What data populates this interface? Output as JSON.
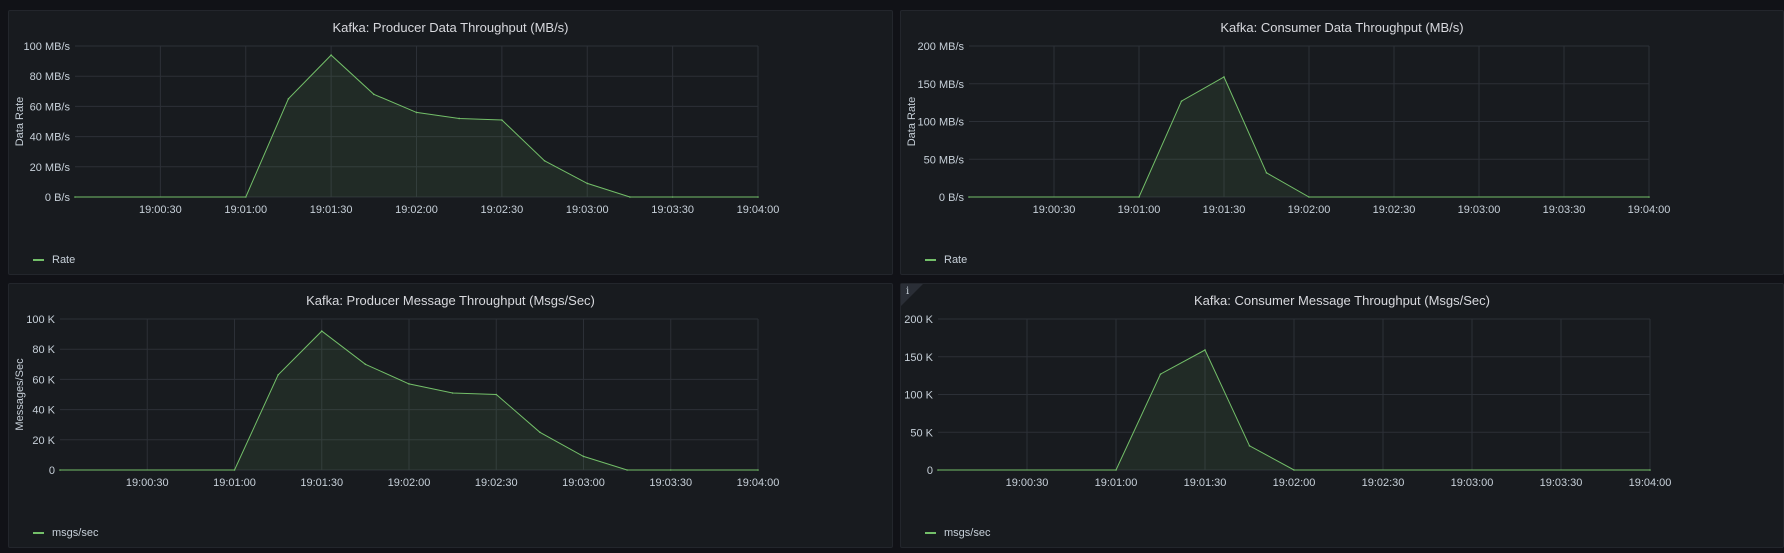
{
  "accent_color": "#73bf69",
  "chart_data": [
    {
      "id": "producer-data",
      "type": "area",
      "title": "Kafka: Producer Data Throughput (MB/s)",
      "ylabel": "Data Rate",
      "ylim": [
        0,
        100
      ],
      "yticks": [
        0,
        20,
        40,
        60,
        80,
        100
      ],
      "ytick_labels": [
        "0 B/s",
        "20 MB/s",
        "40 MB/s",
        "60 MB/s",
        "80 MB/s",
        "100 MB/s"
      ],
      "xlim": [
        "19:00:00",
        "19:04:00"
      ],
      "xtick_labels": [
        "19:00:30",
        "19:01:00",
        "19:01:30",
        "19:02:00",
        "19:02:30",
        "19:03:00",
        "19:03:30",
        "19:04:00"
      ],
      "grid": true,
      "legend_position": "bottom-left",
      "series": [
        {
          "name": "Rate",
          "color": "#73bf69",
          "x": [
            "19:00:00",
            "19:01:00",
            "19:01:15",
            "19:01:30",
            "19:01:45",
            "19:02:00",
            "19:02:15",
            "19:02:30",
            "19:02:45",
            "19:03:00",
            "19:03:15",
            "19:03:30",
            "19:04:00"
          ],
          "y": [
            0,
            0,
            65,
            94,
            68,
            56,
            52,
            51,
            24,
            9,
            0,
            0,
            0
          ]
        }
      ]
    },
    {
      "id": "consumer-data",
      "type": "area",
      "title": "Kafka: Consumer Data Throughput (MB/s)",
      "ylabel": "Data Rate",
      "ylim": [
        0,
        200
      ],
      "yticks": [
        0,
        50,
        100,
        150,
        200
      ],
      "ytick_labels": [
        "0 B/s",
        "50 MB/s",
        "100 MB/s",
        "150 MB/s",
        "200 MB/s"
      ],
      "xlim": [
        "19:00:00",
        "19:04:00"
      ],
      "xtick_labels": [
        "19:00:30",
        "19:01:00",
        "19:01:30",
        "19:02:00",
        "19:02:30",
        "19:03:00",
        "19:03:30",
        "19:04:00"
      ],
      "grid": true,
      "legend_position": "bottom-left",
      "series": [
        {
          "name": "Rate",
          "color": "#73bf69",
          "x": [
            "19:00:00",
            "19:01:00",
            "19:01:15",
            "19:01:30",
            "19:01:45",
            "19:02:00",
            "19:04:00"
          ],
          "y": [
            0,
            0,
            127,
            159,
            32,
            0,
            0
          ]
        }
      ]
    },
    {
      "id": "producer-msgs",
      "type": "area",
      "title": "Kafka: Producer Message Throughput (Msgs/Sec)",
      "ylabel": "Messages/Sec",
      "ylim": [
        0,
        100000
      ],
      "yticks": [
        0,
        20000,
        40000,
        60000,
        80000,
        100000
      ],
      "ytick_labels": [
        "0",
        "20 K",
        "40 K",
        "60 K",
        "80 K",
        "100 K"
      ],
      "xlim": [
        "19:00:00",
        "19:04:00"
      ],
      "xtick_labels": [
        "19:00:30",
        "19:01:00",
        "19:01:30",
        "19:02:00",
        "19:02:30",
        "19:03:00",
        "19:03:30",
        "19:04:00"
      ],
      "grid": true,
      "legend_position": "bottom-left",
      "series": [
        {
          "name": "msgs/sec",
          "color": "#73bf69",
          "x": [
            "19:00:00",
            "19:01:00",
            "19:01:15",
            "19:01:30",
            "19:01:45",
            "19:02:00",
            "19:02:15",
            "19:02:30",
            "19:02:45",
            "19:03:00",
            "19:03:15",
            "19:03:30",
            "19:04:00"
          ],
          "y": [
            0,
            0,
            63000,
            92000,
            70000,
            57000,
            51000,
            50000,
            25000,
            9000,
            0,
            0,
            0
          ]
        }
      ]
    },
    {
      "id": "consumer-msgs",
      "type": "area",
      "title": "Kafka: Consumer Message Throughput (Msgs/Sec)",
      "ylabel": "",
      "ylim": [
        0,
        200000
      ],
      "yticks": [
        0,
        50000,
        100000,
        150000,
        200000
      ],
      "ytick_labels": [
        "0",
        "50 K",
        "100 K",
        "150 K",
        "200 K"
      ],
      "xlim": [
        "19:00:00",
        "19:04:00"
      ],
      "xtick_labels": [
        "19:00:30",
        "19:01:00",
        "19:01:30",
        "19:02:00",
        "19:02:30",
        "19:03:00",
        "19:03:30",
        "19:04:00"
      ],
      "grid": true,
      "legend_position": "bottom-left",
      "info_icon": "info-icon",
      "info_glyph": "i",
      "series": [
        {
          "name": "msgs/sec",
          "color": "#73bf69",
          "x": [
            "19:00:00",
            "19:01:00",
            "19:01:15",
            "19:01:30",
            "19:01:45",
            "19:02:00",
            "19:04:00"
          ],
          "y": [
            0,
            0,
            127000,
            159000,
            32000,
            0,
            0
          ]
        }
      ]
    }
  ]
}
